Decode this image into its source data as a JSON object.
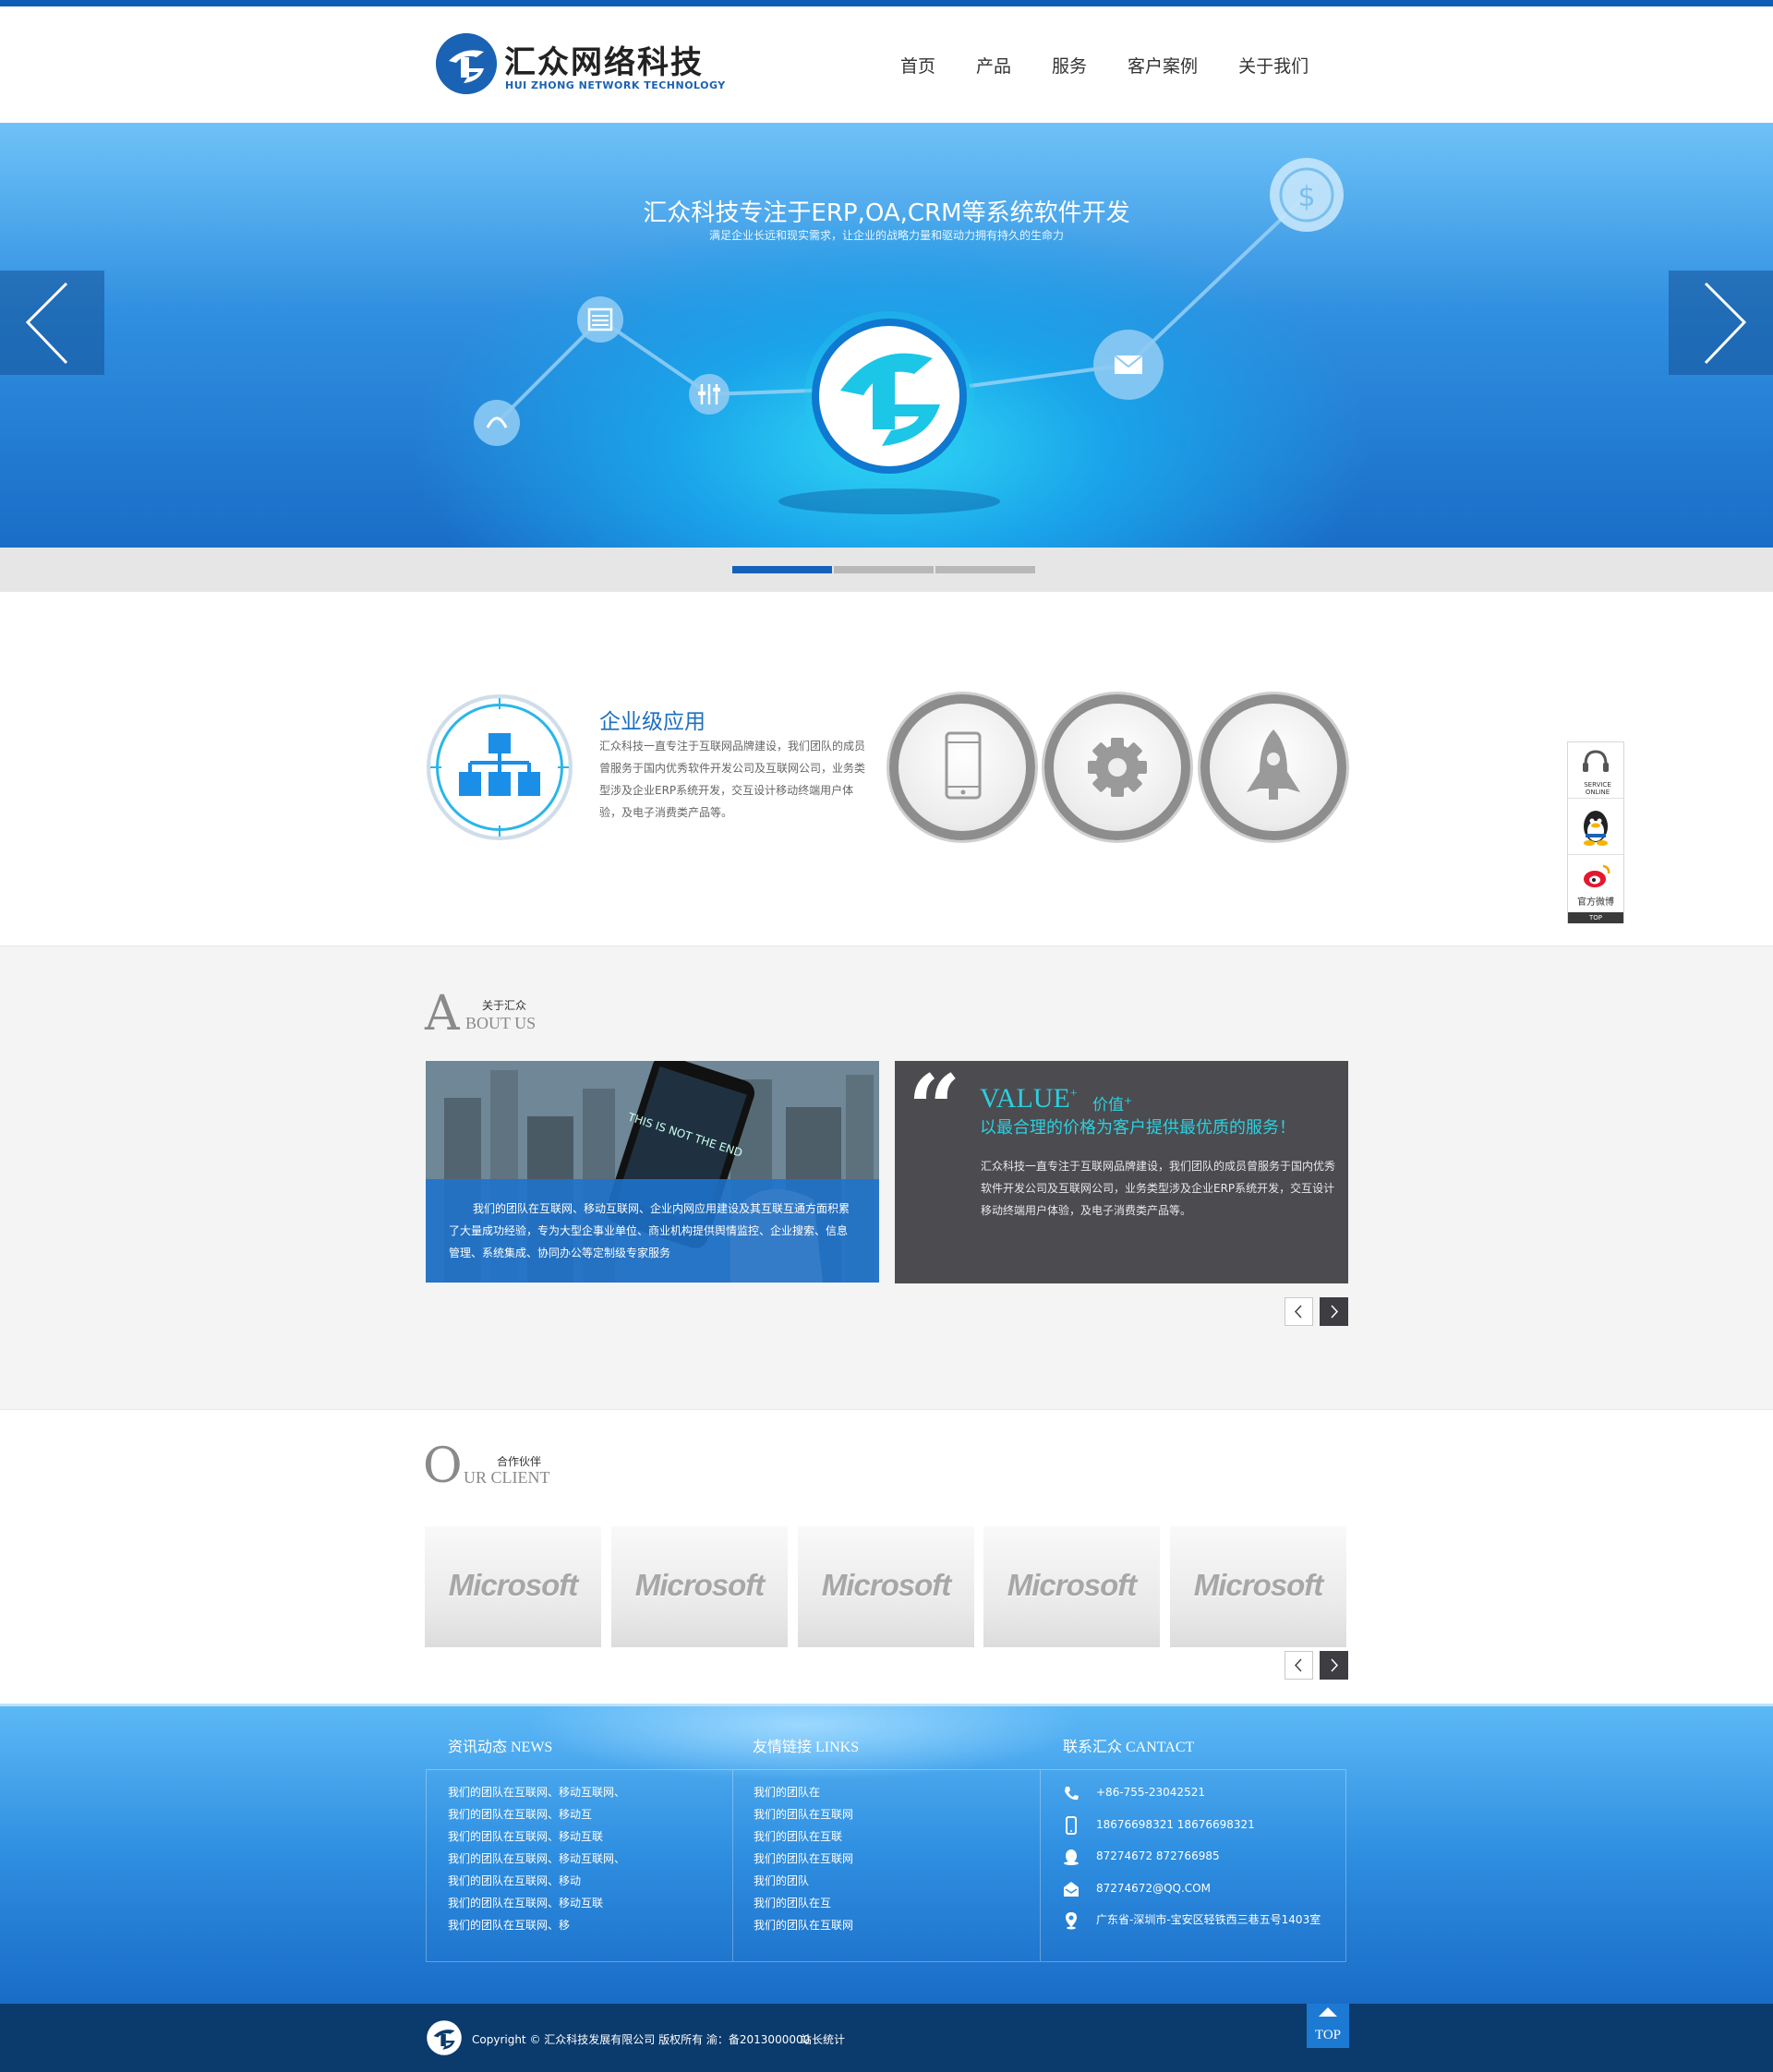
{
  "header": {
    "logo_name": "汇众网络科技",
    "logo_sub": "HUI ZHONG NETWORK TECHNOLOGY",
    "nav": [
      "首页",
      "产品",
      "服务",
      "客户案例",
      "关于我们"
    ]
  },
  "banner": {
    "title": "汇众科技专注于ERP,OA,CRM等系统软件开发",
    "subtitle": "满足企业长远和现实需求，让企业的战略力量和驱动力拥有持久的生命力",
    "slides_total": 3,
    "active_slide": 1
  },
  "features": {
    "title": "企业级应用",
    "description": "汇众科技一直专注于互联网品牌建设，我们团队的成员曾服务于国内优秀软件开发公司及互联网公司，业务类型涉及企业ERP系统开发，交互设计移动终端用户体验，及电子消费类产品等。",
    "icons": [
      "sitemap-icon",
      "mobile-phone-icon",
      "gear-icon",
      "rocket-icon"
    ]
  },
  "side_widget": {
    "service_label": "SERVICE ONLINE",
    "weibo_label": "官方微博",
    "top_label": "TOP"
  },
  "about": {
    "big_letter": "A",
    "cn": "关于汇众",
    "en": "BOUT US",
    "photo_caption": "我们的团队在互联网、移动互联网、企业内网应用建设及其互联互通方面积累了大量成功经验，专为大型企事业单位、商业机构提供舆情监控、企业搜索、信息管理、系统集成、协同办公等定制级专家服务",
    "value_title": "VALUE",
    "value_cn": "价值",
    "value_plus": "+",
    "value_slogan": "以最合理的价格为客户提供最优质的服务！",
    "value_desc": "汇众科技一直专注于互联网品牌建设，我们团队的成员曾服务于国内优秀软件开发公司及互联网公司，业务类型涉及企业ERP系统开发，交互设计移动终端用户体验，及电子消费类产品等。"
  },
  "clients": {
    "big_letter": "O",
    "cn": "合作伙伴",
    "en": "UR CLIENT",
    "logos": [
      "Microsoft",
      "Microsoft",
      "Microsoft",
      "Microsoft",
      "Microsoft"
    ]
  },
  "footer": {
    "news_title": "资讯动态 NEWS",
    "links_title": "友情链接 LINKS",
    "contact_title": "联系汇众 CANTACT",
    "news": [
      "我们的团队在互联网、移动互联网、",
      "我们的团队在互联网、移动互",
      "我们的团队在互联网、移动互联",
      "我们的团队在互联网、移动互联网、",
      "我们的团队在互联网、移动",
      "我们的团队在互联网、移动互联",
      "我们的团队在互联网、移"
    ],
    "links": [
      "我们的团队在",
      "我们的团队在互联网",
      "我们的团队在互联",
      "我们的团队在互联网",
      "我们的团队",
      "我们的团队在互",
      "我们的团队在互联网"
    ],
    "contact": {
      "phone": "+86-755-23042521",
      "mobile": "18676698321    18676698321",
      "qq": "87274672      872766985",
      "email": "87274672@QQ.COM",
      "address": "广东省-深圳市-宝安区轻铁西三巷五号1403室"
    },
    "copyright": "Copyright © 汇众科技发展有限公司 版权所有  渝：备2013000000",
    "stats": "站长统计",
    "top": "TOP"
  }
}
